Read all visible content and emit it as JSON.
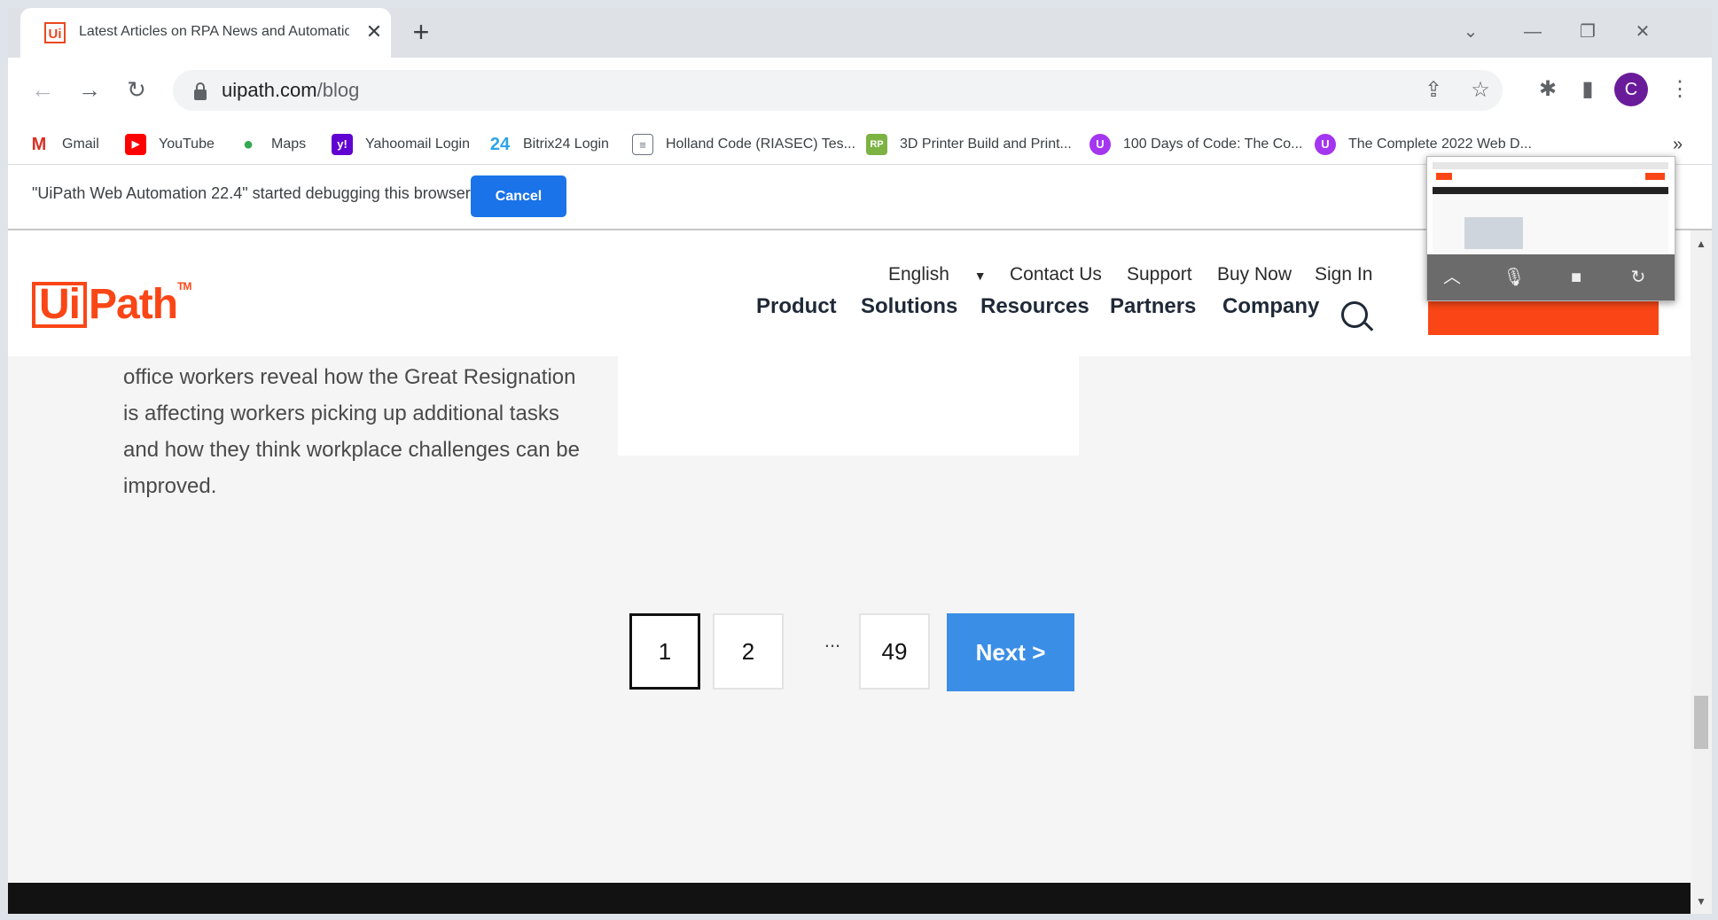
{
  "browser": {
    "tab_title": "Latest Articles on RPA News and Automation",
    "tab_favicon_text": "Ui",
    "url_domain": "uipath.com",
    "url_path": "/blog",
    "profile_initial": "C",
    "icons": {
      "back": "back-arrow-icon",
      "forward": "forward-arrow-icon",
      "reload": "reload-icon",
      "share": "share-icon",
      "star": "star-icon",
      "extensions": "puzzle-icon",
      "side_panel": "side-panel-icon",
      "menu": "kebab-menu-icon"
    }
  },
  "bookmarks": [
    {
      "label": "Gmail",
      "icon": "gmail-icon",
      "color": "#d93025",
      "glyph": "M"
    },
    {
      "label": "YouTube",
      "icon": "youtube-icon",
      "color": "#ff0000",
      "glyph": "▶"
    },
    {
      "label": "Maps",
      "icon": "maps-icon",
      "color": "#34a853",
      "glyph": "●"
    },
    {
      "label": "Yahoomail Login",
      "icon": "yahoo-icon",
      "color": "#6001d2",
      "glyph": "y!"
    },
    {
      "label": "Bitrix24 Login",
      "icon": "bitrix24-icon",
      "color": "#2fa4e7",
      "glyph": "24"
    },
    {
      "label": "Holland Code (RIASEC) Tes...",
      "icon": "document-icon",
      "color": "#6b7280",
      "glyph": "≡"
    },
    {
      "label": "3D Printer Build and Print...",
      "icon": "rp-icon",
      "color": "#7cb342",
      "glyph": "RP"
    },
    {
      "label": "100 Days of Code: The Co...",
      "icon": "udemy-icon",
      "color": "#a435f0",
      "glyph": "U"
    },
    {
      "label": "The Complete 2022 Web D...",
      "icon": "udemy-icon",
      "color": "#a435f0",
      "glyph": "U"
    }
  ],
  "bookmarks_overflow": "»",
  "infobar": {
    "message": "\"UiPath Web Automation 22.4\" started debugging this browser",
    "cancel_label": "Cancel"
  },
  "site": {
    "brand_colors": {
      "orange": "#fa4616",
      "next_blue": "#3a8ee6"
    },
    "logo": {
      "ui": "Ui",
      "path": "Path",
      "tm": "TM"
    },
    "language": "English",
    "utility_nav": [
      "Contact Us",
      "Support",
      "Buy Now",
      "Sign In"
    ],
    "main_nav": [
      "Product",
      "Solutions",
      "Resources",
      "Partners",
      "Company"
    ],
    "article_excerpt": "Results from a new UiPath survey of global office workers reveal how the Great Resignation is affecting workers picking up additional tasks and how they think workplace challenges can be improved.",
    "pagination": {
      "pages": [
        "1",
        "2",
        "49"
      ],
      "ellipsis": "...",
      "active_page": "1",
      "next_label": "Next  >"
    }
  }
}
